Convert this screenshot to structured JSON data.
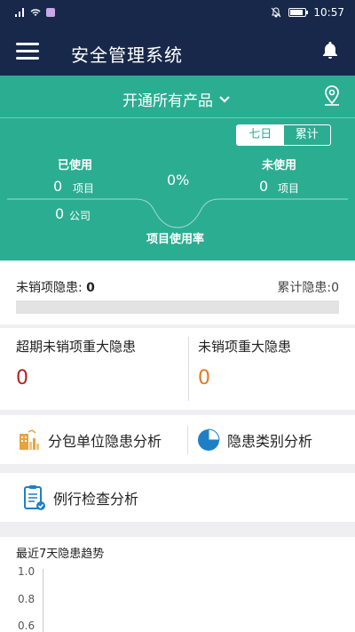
{
  "status": {
    "time": "10:57"
  },
  "app": {
    "title": "安全管理系统"
  },
  "product": {
    "selector_label": "开通所有产品"
  },
  "toggle": {
    "week": "七日",
    "total": "累计",
    "selected": "week"
  },
  "usage": {
    "used_label": "已使用",
    "used_count": "0",
    "used_unit": "项目",
    "company_count": "0",
    "company_unit": "公司",
    "rate": "0%",
    "rate_label": "项目使用率",
    "unused_label": "未使用",
    "unused_count": "0",
    "unused_unit": "项目"
  },
  "hazard": {
    "open_label": "未销项隐患:",
    "open_value": "0",
    "total_label": "累计隐患:",
    "total_value": "0",
    "progress": 0
  },
  "major": {
    "overdue_label": "超期未销项重大隐患",
    "overdue_value": "0",
    "open_label": "未销项重大隐患",
    "open_value": "0"
  },
  "analysis": {
    "sub_unit": "分包单位隐患分析",
    "category": "隐患类别分析",
    "routine": "例行检查分析"
  },
  "trend": {
    "title": "最近7天隐患趋势",
    "y_ticks": [
      "1.0",
      "0.8",
      "0.6"
    ]
  },
  "colors": {
    "header": "#17284a",
    "accent": "#2bad92",
    "overdue": "#b22222",
    "open": "#e07b1f"
  }
}
